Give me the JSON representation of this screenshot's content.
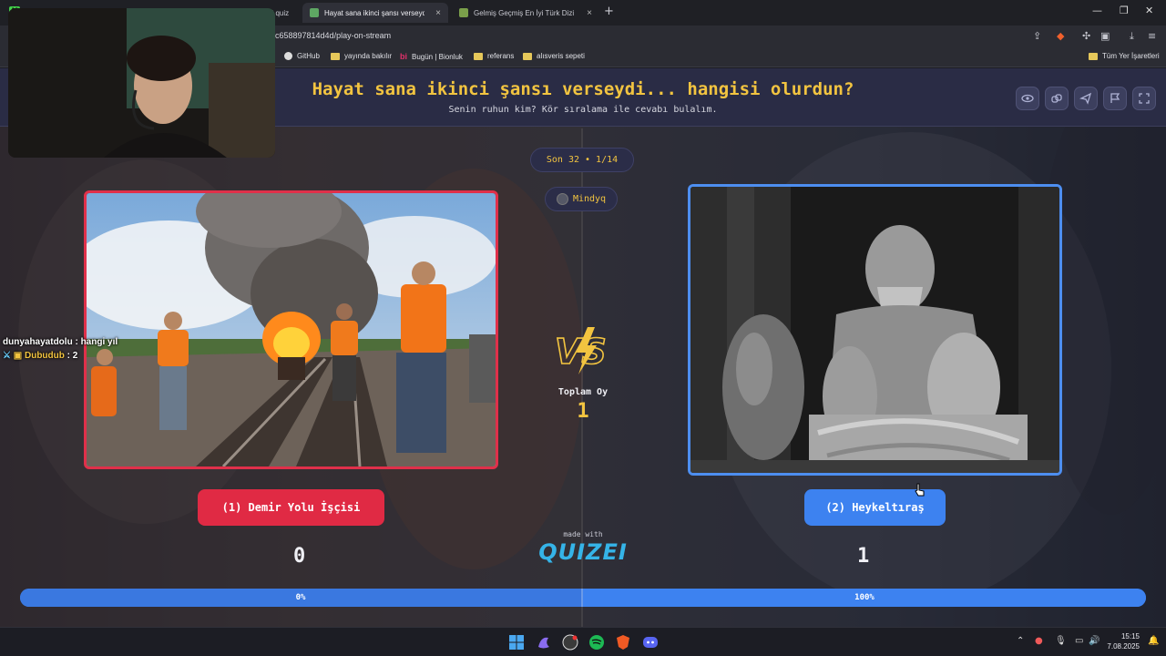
{
  "browser": {
    "tabs": [
      {
        "label": "mli quiz",
        "active": false
      },
      {
        "label": "Hayat sana ikinci şansı verseydi...",
        "active": true
      },
      {
        "label": "Gelmiş Geçmiş En İyi Türk Dizi Film K",
        "active": false
      }
    ],
    "url": "c658897814d4d/play-on-stream",
    "bookmarks": [
      "GitHub",
      "yayında bakılır",
      "Bugün | Bionluk",
      "referans",
      "alısveris sepeti"
    ],
    "all_bookmarks": "Tüm Yer İşaretleri"
  },
  "quiz": {
    "title": "Hayat sana ikinci şansı verseydi... hangisi olurdun?",
    "subtitle": "Senin ruhun kim? Kör sıralama ile cevabı bulalım.",
    "round": "Son 32 • 1/14",
    "user": "Mindyq",
    "vs": "VS",
    "total_label": "Toplam Oy",
    "total_votes": "1",
    "left": {
      "label": "(1) Demir Yolu İşçisi",
      "votes": "0",
      "percent_label": "0%",
      "percent": 50
    },
    "right": {
      "label": "(2) Heykeltıraş",
      "votes": "1",
      "percent_label": "100%",
      "percent": 50
    },
    "made_with": "made with",
    "brand": "QUIZEI"
  },
  "chat": [
    {
      "user": "dunyahayatdolu",
      "message": "hangi yıl"
    },
    {
      "user": "Dubudub",
      "message": "2"
    }
  ],
  "taskbar": {
    "time": "15:15",
    "date": "7.08.2025"
  },
  "colors": {
    "accent_yellow": "#f2c440",
    "left_red": "#e02a44",
    "right_blue": "#3d82f0",
    "header_bg": "#2a2c45"
  },
  "icons": [
    "eye-icon",
    "link-icon",
    "send-icon",
    "flag-icon",
    "fullscreen-icon"
  ]
}
